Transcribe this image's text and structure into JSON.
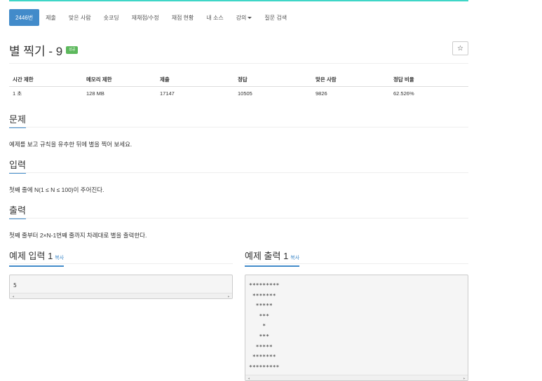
{
  "nav": {
    "items": [
      {
        "label": "2446번",
        "active": true
      },
      {
        "label": "제출"
      },
      {
        "label": "맞은 사람"
      },
      {
        "label": "숏코딩"
      },
      {
        "label": "재채점/수정"
      },
      {
        "label": "채점 현황"
      },
      {
        "label": "내 소스"
      },
      {
        "label": "강의"
      },
      {
        "label": "질문 검색"
      }
    ]
  },
  "problem": {
    "title": "별 찍기 - 9",
    "badge": "성공",
    "star_icon": "☆"
  },
  "info_table": {
    "headers": [
      "시간 제한",
      "메모리 제한",
      "제출",
      "정답",
      "맞은 사람",
      "정답 비율"
    ],
    "values": [
      "1 초",
      "128 MB",
      "17147",
      "10505",
      "9826",
      "62.526%"
    ]
  },
  "sections": {
    "problem_label": "문제",
    "problem_text": "예제를 보고 규칙을 유추한 뒤에 별을 찍어 보세요.",
    "input_label": "입력",
    "input_text": "첫째 줄에 N(1 ≤ N ≤ 100)이 주어진다.",
    "output_label": "출력",
    "output_text": "첫째 줄부터 2×N-1번째 줄까지 차례대로 별을 출력한다."
  },
  "samples": {
    "input_label": "예제 입력 1",
    "output_label": "예제 출력 1",
    "copy_label": "복사",
    "input_value": "5",
    "output_value": "*********\n *******\n  *****\n   ***\n    *\n   ***\n  *****\n *******\n*********"
  },
  "colors": {
    "accent": "#428bca",
    "success": "#5cb85c",
    "top_line": "#3ed6c7"
  }
}
